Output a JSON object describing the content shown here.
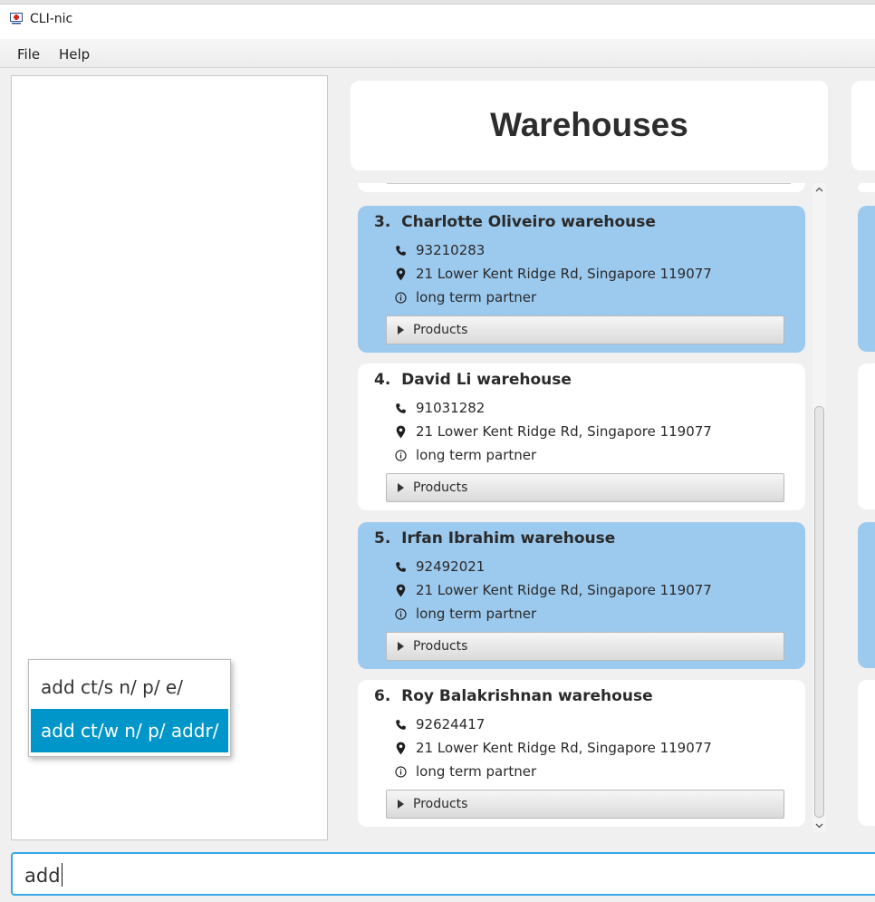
{
  "window": {
    "title": "CLI-nic"
  },
  "menu": {
    "items": [
      "File",
      "Help"
    ]
  },
  "header": {
    "title": "Warehouses"
  },
  "warehouses": [
    {
      "index": "3.",
      "name": "Charlotte Oliveiro warehouse",
      "phone": "93210283",
      "address": "21 Lower Kent Ridge Rd, Singapore 119077",
      "remark": "long term partner",
      "products_label": "Products",
      "selected": true
    },
    {
      "index": "4.",
      "name": "David Li warehouse",
      "phone": "91031282",
      "address": "21 Lower Kent Ridge Rd, Singapore 119077",
      "remark": "long term partner",
      "products_label": "Products",
      "selected": false
    },
    {
      "index": "5.",
      "name": "Irfan Ibrahim warehouse",
      "phone": "92492021",
      "address": "21 Lower Kent Ridge Rd, Singapore 119077",
      "remark": "long term partner",
      "products_label": "Products",
      "selected": true
    },
    {
      "index": "6.",
      "name": "Roy Balakrishnan warehouse",
      "phone": "92624417",
      "address": "21 Lower Kent Ridge Rd, Singapore 119077",
      "remark": "long term partner",
      "products_label": "Products",
      "selected": false
    }
  ],
  "autocomplete": {
    "options": [
      "add ct/s n/ p/ e/",
      "add ct/w n/ p/ addr/"
    ],
    "highlighted": "add ct/w n/ p/ addr/"
  },
  "command_box": {
    "value": "add"
  },
  "colors": {
    "selected_card": "#9cc9ee",
    "card": "#ffffff",
    "accent": "#0096c9",
    "focus_border": "#38a8e6"
  },
  "icons": {
    "phone": "phone-icon",
    "address": "map-pin-icon",
    "remark": "info-icon",
    "expand": "triangle-right-icon"
  }
}
